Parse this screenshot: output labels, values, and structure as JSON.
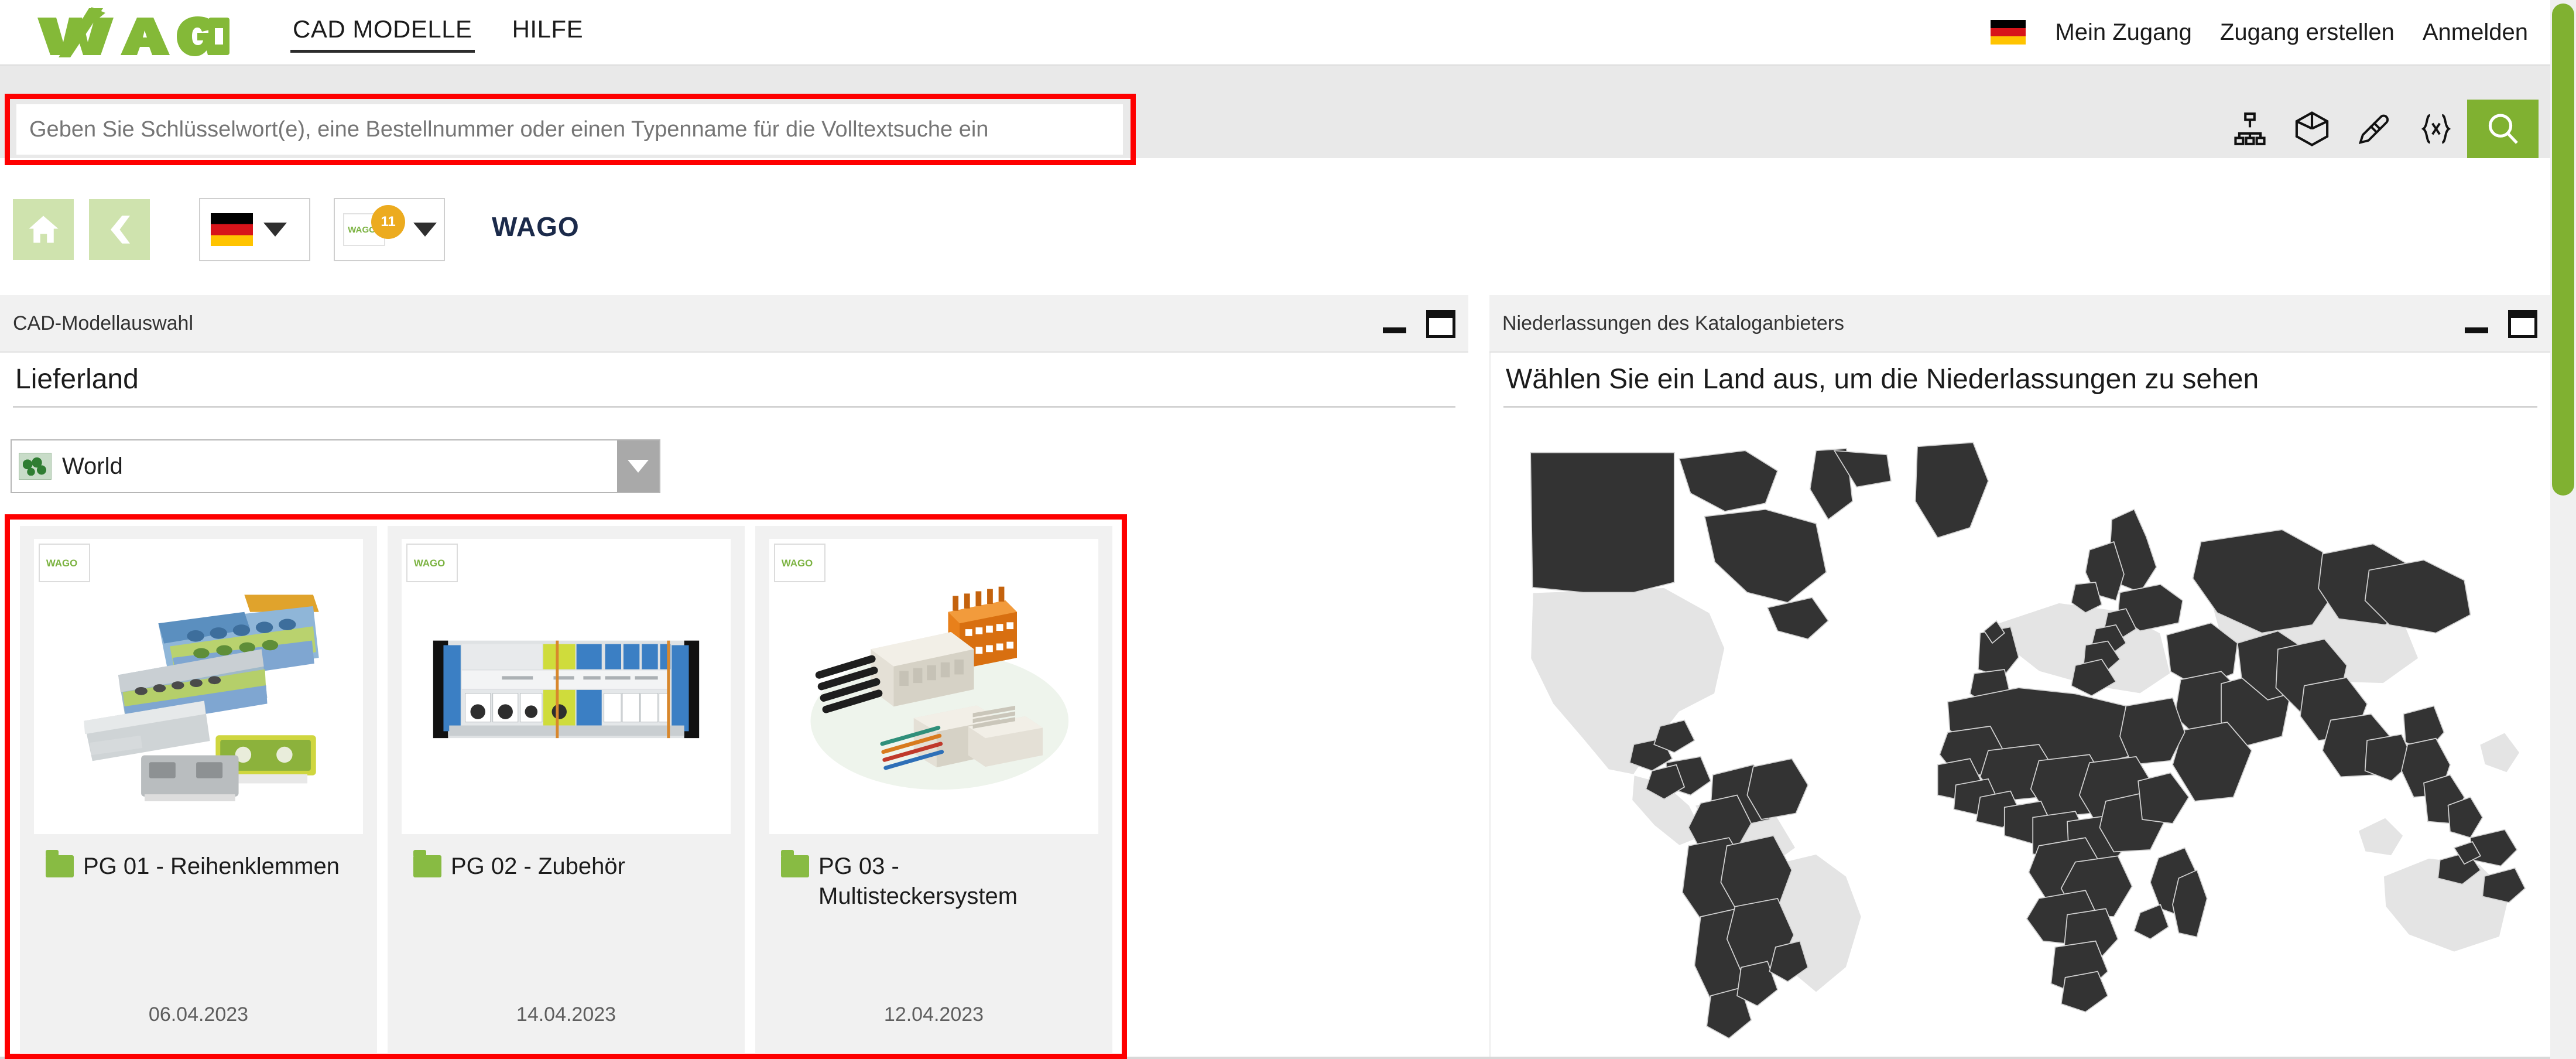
{
  "header": {
    "logo_text": "WAGO",
    "nav": [
      {
        "label": "CAD MODELLE",
        "active": true
      },
      {
        "label": "HILFE",
        "active": false
      }
    ],
    "flag_icon": "flag-de-icon",
    "links": [
      {
        "label": "Mein Zugang"
      },
      {
        "label": "Zugang erstellen"
      },
      {
        "label": "Anmelden"
      }
    ]
  },
  "search": {
    "value": "",
    "placeholder": "Geben Sie Schlüsselwort(e), eine Bestellnummer oder einen Typenname für die Volltextsuche ein",
    "icons": [
      {
        "name": "hierarchy-tree-icon"
      },
      {
        "name": "cube-3d-icon"
      },
      {
        "name": "pencil-edit-icon"
      },
      {
        "name": "variables-braces-icon"
      }
    ],
    "submit_icon": "search-icon",
    "highlight_color": "#fe0000",
    "button_color": "#80b131"
  },
  "scrollbar": {
    "thumb_color": "#80b131"
  },
  "toolbar": {
    "home_icon": "home-icon",
    "back_icon": "arrow-left-icon",
    "language_dropdown": {
      "flag_icon": "flag-de-icon",
      "caret_icon": "chevron-down-icon"
    },
    "catalog_dropdown": {
      "logo_text": "WAGO",
      "badge_number": "11",
      "caret_icon": "chevron-down-icon"
    },
    "brand": "WAGO"
  },
  "panels": {
    "left": {
      "title": "CAD-Modellauswahl",
      "minimize_icon": "minimize-icon",
      "maximize_icon": "maximize-icon",
      "section_title": "Lieferland",
      "country_select": {
        "value": "World",
        "icon": "world-map-icon",
        "arrow_icon": "chevron-down-icon"
      },
      "cards": [
        {
          "badge": "WAGO",
          "folder_icon": "folder-icon",
          "title": "PG 01 - Reihenklemmen",
          "date": "06.04.2023",
          "image": "terminal-blocks-photo"
        },
        {
          "badge": "WAGO",
          "folder_icon": "folder-icon",
          "title": "PG 02 - Zubehör",
          "date": "14.04.2023",
          "image": "accessories-rail-photo"
        },
        {
          "badge": "WAGO",
          "folder_icon": "folder-icon",
          "title": "PG 03 - Multisteckersystem",
          "date": "12.04.2023",
          "image": "multi-connector-photo"
        }
      ]
    },
    "right": {
      "title": "Niederlassungen des Kataloganbieters",
      "minimize_icon": "minimize-icon",
      "maximize_icon": "maximize-icon",
      "heading": "Wählen Sie ein Land aus, um die Niederlassungen zu sehen",
      "map": {
        "name": "world-choropleth-map",
        "selected_color": "#333333",
        "unselected_color": "#e4e4e4"
      }
    }
  }
}
